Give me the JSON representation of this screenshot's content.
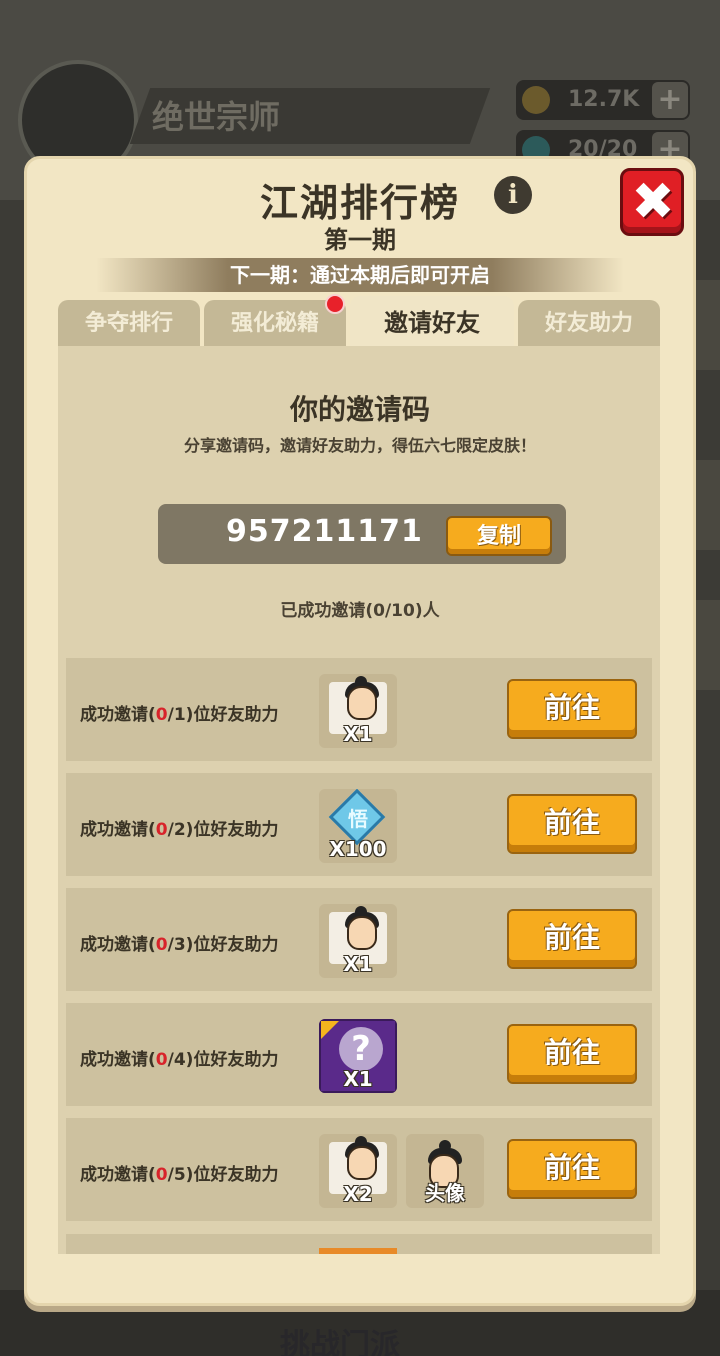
{
  "background": {
    "player_name": "绝世宗师",
    "gold": "12.7K",
    "energy": "20/20",
    "bottom_title": "挑战门派"
  },
  "dialog": {
    "title": "江湖排行榜",
    "subtitle": "第一期",
    "next_period": "下一期：通过本期后即可开启",
    "tabs": [
      "争夺排行",
      "强化秘籍",
      "邀请好友",
      "好友助力"
    ],
    "active_tab": "邀请好友",
    "invite_title": "你的邀请码",
    "invite_desc": "分享邀请码，邀请好友助力，得伍六七限定皮肤！",
    "invite_code": "957211171",
    "copy_label": "复制",
    "invited_count": "已成功邀请(0/10)人",
    "go_label": "前往"
  },
  "tasks": [
    {
      "prefix": "成功邀请(",
      "done": "0",
      "total": "/1",
      "suffix": ")位好友助力",
      "rewards": [
        {
          "icon": "character-shard-icon",
          "qty": "X1"
        }
      ]
    },
    {
      "prefix": "成功邀请(",
      "done": "0",
      "total": "/2",
      "suffix": ")位好友助力",
      "rewards": [
        {
          "icon": "enlightenment-gem-icon",
          "glyph": "悟",
          "qty": "X100"
        }
      ]
    },
    {
      "prefix": "成功邀请(",
      "done": "0",
      "total": "/3",
      "suffix": ")位好友助力",
      "rewards": [
        {
          "icon": "character-shard-icon",
          "qty": "X1"
        }
      ]
    },
    {
      "prefix": "成功邀请(",
      "done": "0",
      "total": "/4",
      "suffix": ")位好友助力",
      "rewards": [
        {
          "icon": "mystery-box-icon",
          "glyph": "?",
          "qty": "X1"
        }
      ]
    },
    {
      "prefix": "成功邀请(",
      "done": "0",
      "total": "/5",
      "suffix": ")位好友助力",
      "rewards": [
        {
          "icon": "character-shard-icon",
          "qty": "X2"
        },
        {
          "icon": "avatar-icon",
          "qty": "头像"
        }
      ]
    }
  ],
  "colors": {
    "dialog_bg": "#f2e6c4",
    "button_orange": "#f6ab1e",
    "close_red": "#e01f25",
    "progress_red": "#d8232a"
  }
}
